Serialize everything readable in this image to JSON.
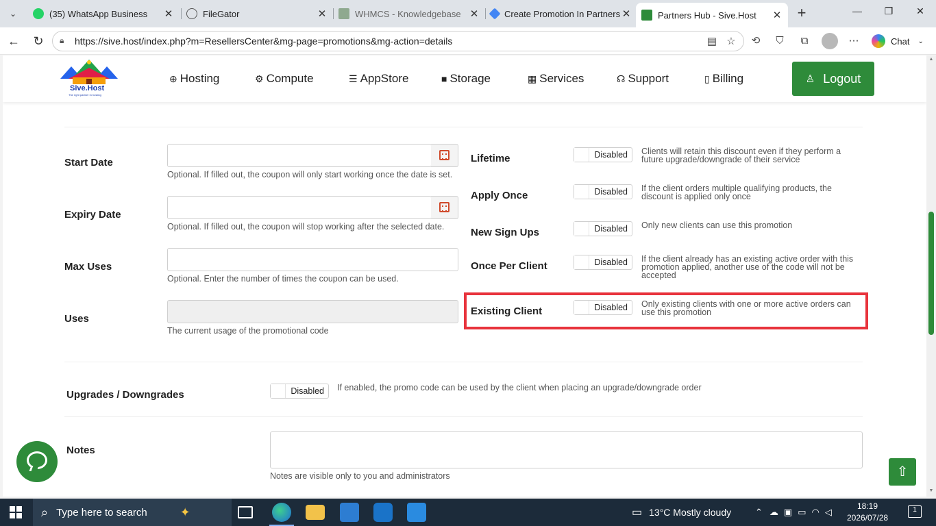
{
  "browser": {
    "tabs": [
      {
        "title": "(35) WhatsApp Business",
        "icon": "whatsapp-icon",
        "color": "#25d366"
      },
      {
        "title": "FileGator",
        "icon": "globe-icon",
        "color": "#555555"
      },
      {
        "title": "WHMCS - Knowledgebase",
        "icon": "whmcs-icon",
        "color": "#6b8e6b"
      },
      {
        "title": "Create Promotion In Partners H",
        "icon": "gemini-icon",
        "color": "#4285f4"
      },
      {
        "title": "Partners Hub - Sive.Host",
        "icon": "sivehost-icon",
        "color": "#2e8b3a"
      }
    ],
    "url": "https://sive.host/index.php?m=ResellersCenter&mg-page=promotions&mg-action=details",
    "chat_label": "Chat"
  },
  "site": {
    "logo_text": "Sive.Host",
    "logo_tagline": "The right partner in hosting",
    "nav": [
      {
        "label": "Hosting",
        "icon": "globe-icon"
      },
      {
        "label": "Compute",
        "icon": "gear-icon"
      },
      {
        "label": "AppStore",
        "icon": "database-icon"
      },
      {
        "label": "Storage",
        "icon": "box-icon"
      },
      {
        "label": "Services",
        "icon": "gift-icon"
      },
      {
        "label": "Support",
        "icon": "headset-icon"
      },
      {
        "label": "Billing",
        "icon": "receipt-icon"
      }
    ],
    "logout_label": "Logout",
    "accent": "#2e8b3a"
  },
  "form": {
    "start_date": {
      "label": "Start Date",
      "value": "",
      "help": "Optional. If filled out, the coupon will only start working once the date is set."
    },
    "expiry_date": {
      "label": "Expiry Date",
      "value": "",
      "help": "Optional. If filled out, the coupon will stop working after the selected date."
    },
    "max_uses": {
      "label": "Max Uses",
      "value": "",
      "help": "Optional. Enter the number of times the coupon can be used."
    },
    "uses": {
      "label": "Uses",
      "value": "",
      "help": "The current usage of the promotional code"
    },
    "toggles": [
      {
        "label": "Lifetime",
        "state": "Disabled",
        "desc": "Clients will retain this discount even if they perform a future upgrade/downgrade of their service"
      },
      {
        "label": "Apply Once",
        "state": "Disabled",
        "desc": "If the client orders multiple qualifying products, the discount is applied only once"
      },
      {
        "label": "New Sign Ups",
        "state": "Disabled",
        "desc": "Only new clients can use this promotion"
      },
      {
        "label": "Once Per Client",
        "state": "Disabled",
        "desc": "If the client already has an existing active order with this promotion applied, another use of the code will not be accepted"
      },
      {
        "label": "Existing Client",
        "state": "Disabled",
        "desc": "Only existing clients with one or more active orders can use this promotion"
      }
    ],
    "upgrades": {
      "label": "Upgrades / Downgrades",
      "state": "Disabled",
      "desc": "If enabled, the promo code can be used by the client when placing an upgrade/downgrade order"
    },
    "notes": {
      "label": "Notes",
      "value": "",
      "help": "Notes are visible only to you and administrators"
    }
  },
  "taskbar": {
    "search_placeholder": "Type here to search",
    "weather": "13°C  Mostly cloudy",
    "time": "18:19",
    "date": "2026/07/28",
    "notifications": "1"
  }
}
